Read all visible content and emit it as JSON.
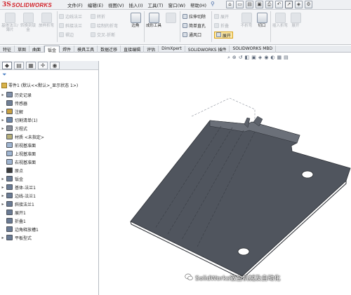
{
  "app": {
    "logo_ds": "3S",
    "logo_name": "SOLIDWORKS"
  },
  "menu": [
    "文件(F)",
    "编辑(E)",
    "视图(V)",
    "插入(I)",
    "工具(T)",
    "窗口(W)",
    "帮助(H)"
  ],
  "ribbon": {
    "left_group": [
      {
        "label": "基体法兰/薄片"
      },
      {
        "label": "转换到钣金"
      },
      {
        "label": "放样折弯"
      }
    ],
    "mid_small": [
      "边线法兰",
      "斜接法兰",
      "褶边",
      "转折",
      "绘制的折弯",
      "交叉-折断"
    ],
    "corner_label": "边角",
    "forming_tool_label": "成形工具",
    "extrude_cut_label": "拉伸切除",
    "simple_hole_label": "简单直孔",
    "vent_label": "通风口",
    "unfold_label": "展开",
    "fold_label": "折叠",
    "unfold_right_label": "展开",
    "flatten_label": "展开",
    "no_bends_label": "不折弯",
    "insert_bends_label": "插入折弯",
    "rip_label": "切口"
  },
  "tabs": [
    "特征",
    "草图",
    "曲面",
    "钣金",
    "焊件",
    "模具工具",
    "数据迁移",
    "直接编辑",
    "评估",
    "DimXpert",
    "SOLIDWORKS 插件",
    "SOLIDWORKS MBD"
  ],
  "active_tab": 3,
  "tree": {
    "root": "零件1 (默认<<默认>_显示状态 1>)",
    "items": [
      {
        "label": "历史记录",
        "exp": "▸",
        "color": "#7f8fa8"
      },
      {
        "label": "传感器",
        "exp": "",
        "color": "#6f7f96"
      },
      {
        "label": "注解",
        "exp": "▸",
        "color": "#c8a040"
      },
      {
        "label": "切割清单(1)",
        "exp": "▸",
        "color": "#6d86a8"
      },
      {
        "label": "方程式",
        "exp": "▸",
        "color": "#8a8f99"
      },
      {
        "label": "材质 <未指定>",
        "exp": "",
        "color": "#b7b07a"
      },
      {
        "label": "前视基准面",
        "exp": "",
        "color": "#9fb5d1"
      },
      {
        "label": "上视基准面",
        "exp": "",
        "color": "#9fb5d1"
      },
      {
        "label": "右视基准面",
        "exp": "",
        "color": "#9fb5d1"
      },
      {
        "label": "原点",
        "exp": "",
        "color": "#3a3a3a"
      },
      {
        "label": "钣金",
        "exp": "▸",
        "color": "#6a7b94"
      },
      {
        "label": "基体-法兰1",
        "exp": "▸",
        "color": "#6a7b94"
      },
      {
        "label": "边线-法兰1",
        "exp": "▸",
        "color": "#6a7b94"
      },
      {
        "label": "斜接法兰1",
        "exp": "▸",
        "color": "#6a7b94"
      },
      {
        "label": "展开1",
        "exp": "",
        "color": "#6a7b94"
      },
      {
        "label": "折叠1",
        "exp": "",
        "color": "#6a7b94"
      },
      {
        "label": "边角释放槽1",
        "exp": "",
        "color": "#6a7b94"
      },
      {
        "label": "平板型式",
        "exp": "▸",
        "color": "#6a7b94"
      }
    ]
  },
  "watermark": "SolidWorks钣金机械及自动化",
  "colors": {
    "part_face": "#50555e",
    "part_edge": "#2a2d33",
    "highlight": "#fbe7a6"
  }
}
